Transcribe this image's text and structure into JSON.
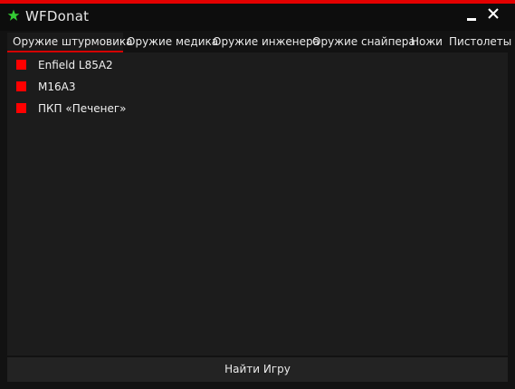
{
  "window": {
    "title": "WFDonat"
  },
  "colors": {
    "accent": "#e30000",
    "checkbox": "#ff0000",
    "icon": "#33cc33"
  },
  "tabs": [
    {
      "label": "Оружие штурмовика",
      "active": true
    },
    {
      "label": "Оружие медика",
      "active": false
    },
    {
      "label": "Оружие инженера",
      "active": false
    },
    {
      "label": "Оружие снайпера",
      "active": false
    },
    {
      "label": "Ножи",
      "active": false
    },
    {
      "label": "Пистолеты",
      "active": false
    }
  ],
  "items": [
    {
      "label": "Enfield L85A2"
    },
    {
      "label": "M16A3"
    },
    {
      "label": "ПКП «Печенег»"
    }
  ],
  "actions": {
    "find_game": "Найти Игру"
  }
}
